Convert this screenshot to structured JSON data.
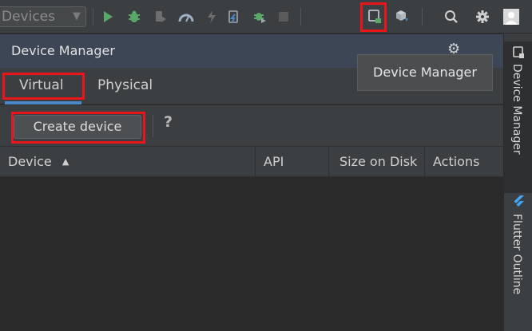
{
  "toolbar": {
    "devices_combo_value": "Devices",
    "icons": [
      "run-icon",
      "debug-icon",
      "attach-debugger-icon",
      "profile-icon",
      "apply-changes-icon",
      "apply-code-changes-icon",
      "attach-flutter-icon",
      "stop-icon",
      "device-manager-icon",
      "sdk-manager-icon",
      "search-icon",
      "settings-icon",
      "avatar"
    ]
  },
  "panel": {
    "title": "Device Manager",
    "tabs": [
      {
        "label": "Virtual",
        "selected": true
      },
      {
        "label": "Physical",
        "selected": false
      }
    ],
    "create_button": "Create device",
    "help": "?",
    "columns": [
      {
        "label": "Device",
        "sorted": "ascending"
      },
      {
        "label": "API"
      },
      {
        "label": "Size on Disk"
      },
      {
        "label": "Actions"
      }
    ],
    "rows": []
  },
  "tooltip": {
    "text": "Device Manager"
  },
  "right_strip": {
    "tabs": [
      {
        "label": "Device Manager",
        "active": true
      },
      {
        "label": "Flutter Outline",
        "active": false
      }
    ]
  },
  "colors": {
    "highlight_box": "#e8151b",
    "accent_underline": "#4a88c7",
    "run_green": "#59a869",
    "header_blue": "#3c4655"
  }
}
